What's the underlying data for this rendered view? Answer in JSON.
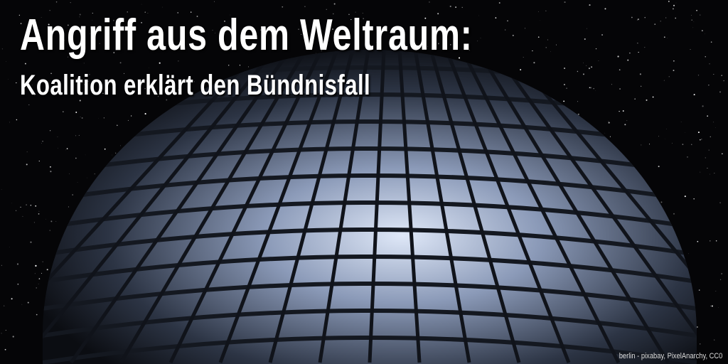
{
  "headline": {
    "title": "Angriff aus dem Weltraum:",
    "subtitle": "Koalition erklärt den Bündnisfall"
  },
  "credit": "berlin - pixabay, PixelAnarchy, CC0",
  "image": {
    "subject": "glass-dome-night",
    "colors": {
      "sky": "#050507",
      "glow": "#c8d8f0",
      "frame": "#1a1e26"
    }
  }
}
